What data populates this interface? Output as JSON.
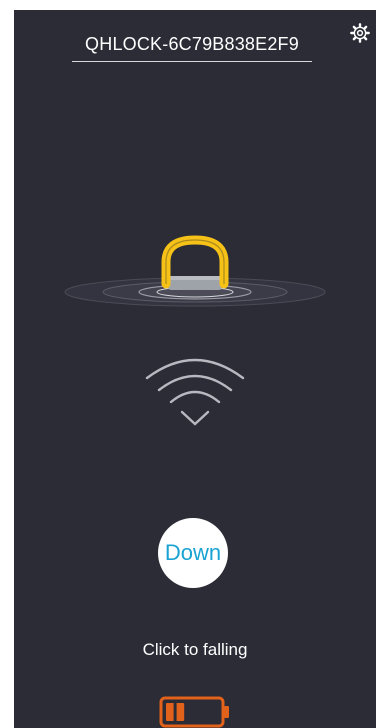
{
  "device": {
    "name": "QHLOCK-6C79B838E2F9"
  },
  "icons": {
    "settings": "gear-icon",
    "lock": "parking-lock-icon",
    "signal": "wireless-signal-icon",
    "battery": "battery-low-icon"
  },
  "control": {
    "button_label": "Down",
    "hint": "Click to falling"
  },
  "battery": {
    "level": 0.35
  },
  "colors": {
    "background": "#2b2c36",
    "accent": "#1aa3d2",
    "lock_yellow": "#f6c218",
    "battery_orange": "#e2621c"
  }
}
